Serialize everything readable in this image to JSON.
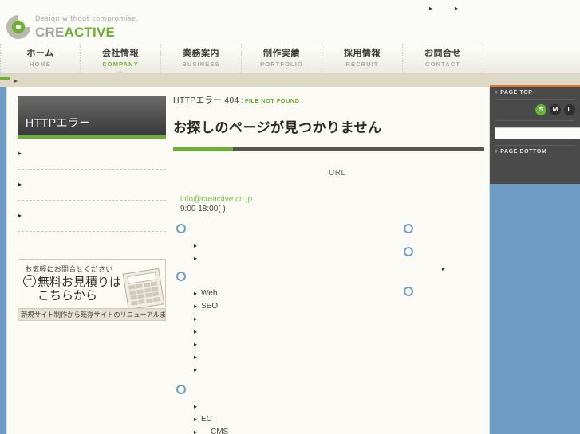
{
  "site": {
    "tagline": "Design without compromise.",
    "brand_part1": "CRE",
    "brand_part2": "ACTIVE"
  },
  "header": {
    "utility_links": [
      "",
      ""
    ]
  },
  "nav": {
    "items": [
      {
        "ja": "ホーム",
        "en": "HOME",
        "active": false
      },
      {
        "ja": "会社情報",
        "en": "COMPANY",
        "active": true
      },
      {
        "ja": "業務案内",
        "en": "BUSINESS",
        "active": false
      },
      {
        "ja": "制作実績",
        "en": "PORTFOLIO",
        "active": false
      },
      {
        "ja": "採用情報",
        "en": "RECRUIT",
        "active": false
      },
      {
        "ja": "お問合せ",
        "en": "CONTACT",
        "active": false
      }
    ]
  },
  "breadcrumb": {
    "text": ""
  },
  "sidebar": {
    "box_title": "HTTPエラー",
    "links": [
      {
        "label": ""
      },
      {
        "label": ""
      },
      {
        "label": ""
      }
    ],
    "banner": {
      "lead": "お気軽にお問合せください",
      "line1": "無料お見積りは",
      "line2": "こちらから",
      "foot": "新規サイト制作から既存サイトのリニューアルまで"
    }
  },
  "main": {
    "error_label": "HTTPエラー",
    "error_code": "404",
    "separator": ":",
    "error_status": "FILE NOT FOUND",
    "headline": "お探しのページが見つかりません",
    "url_label": "URL",
    "contact_mail": "info@creactive.co.jp",
    "contact_hours": "9:00 18:00(    )"
  },
  "sitemap": {
    "column_a": [
      {
        "type": "head",
        "label": ""
      },
      {
        "type": "sub",
        "label": ""
      },
      {
        "type": "sub",
        "label": ""
      },
      {
        "type": "head",
        "label": ""
      },
      {
        "type": "sub",
        "label": "Web"
      },
      {
        "type": "sub",
        "label": "SEO"
      },
      {
        "type": "sub",
        "label": ""
      },
      {
        "type": "sub",
        "label": ""
      },
      {
        "type": "sub",
        "label": ""
      },
      {
        "type": "sub",
        "label": ""
      },
      {
        "type": "sub",
        "label": ""
      },
      {
        "type": "head",
        "label": ""
      },
      {
        "type": "sub",
        "label": ""
      },
      {
        "type": "sub",
        "label": "EC"
      },
      {
        "type": "sub-indent",
        "label": "CMS"
      }
    ],
    "column_b": [
      {
        "type": "head",
        "label": ""
      },
      {
        "type": "head",
        "label": ""
      },
      {
        "type": "sub",
        "label": ""
      },
      {
        "type": "head",
        "label": ""
      }
    ]
  },
  "right_panel": {
    "page_top": "+ PAGE TOP",
    "page_bottom": "+ PAGE BOTTOM",
    "text_sizes": [
      {
        "label": "S",
        "selected": true
      },
      {
        "label": "M",
        "selected": false
      },
      {
        "label": "L",
        "selected": false
      }
    ],
    "search_value": "",
    "search_placeholder": ""
  },
  "colors": {
    "accent_green": "#6cb033",
    "page_background": "#6d9cc4",
    "panel_dark": "#4a4a4a",
    "orange_rule": "#e8722a",
    "ring_blue": "#6e9cc6"
  }
}
